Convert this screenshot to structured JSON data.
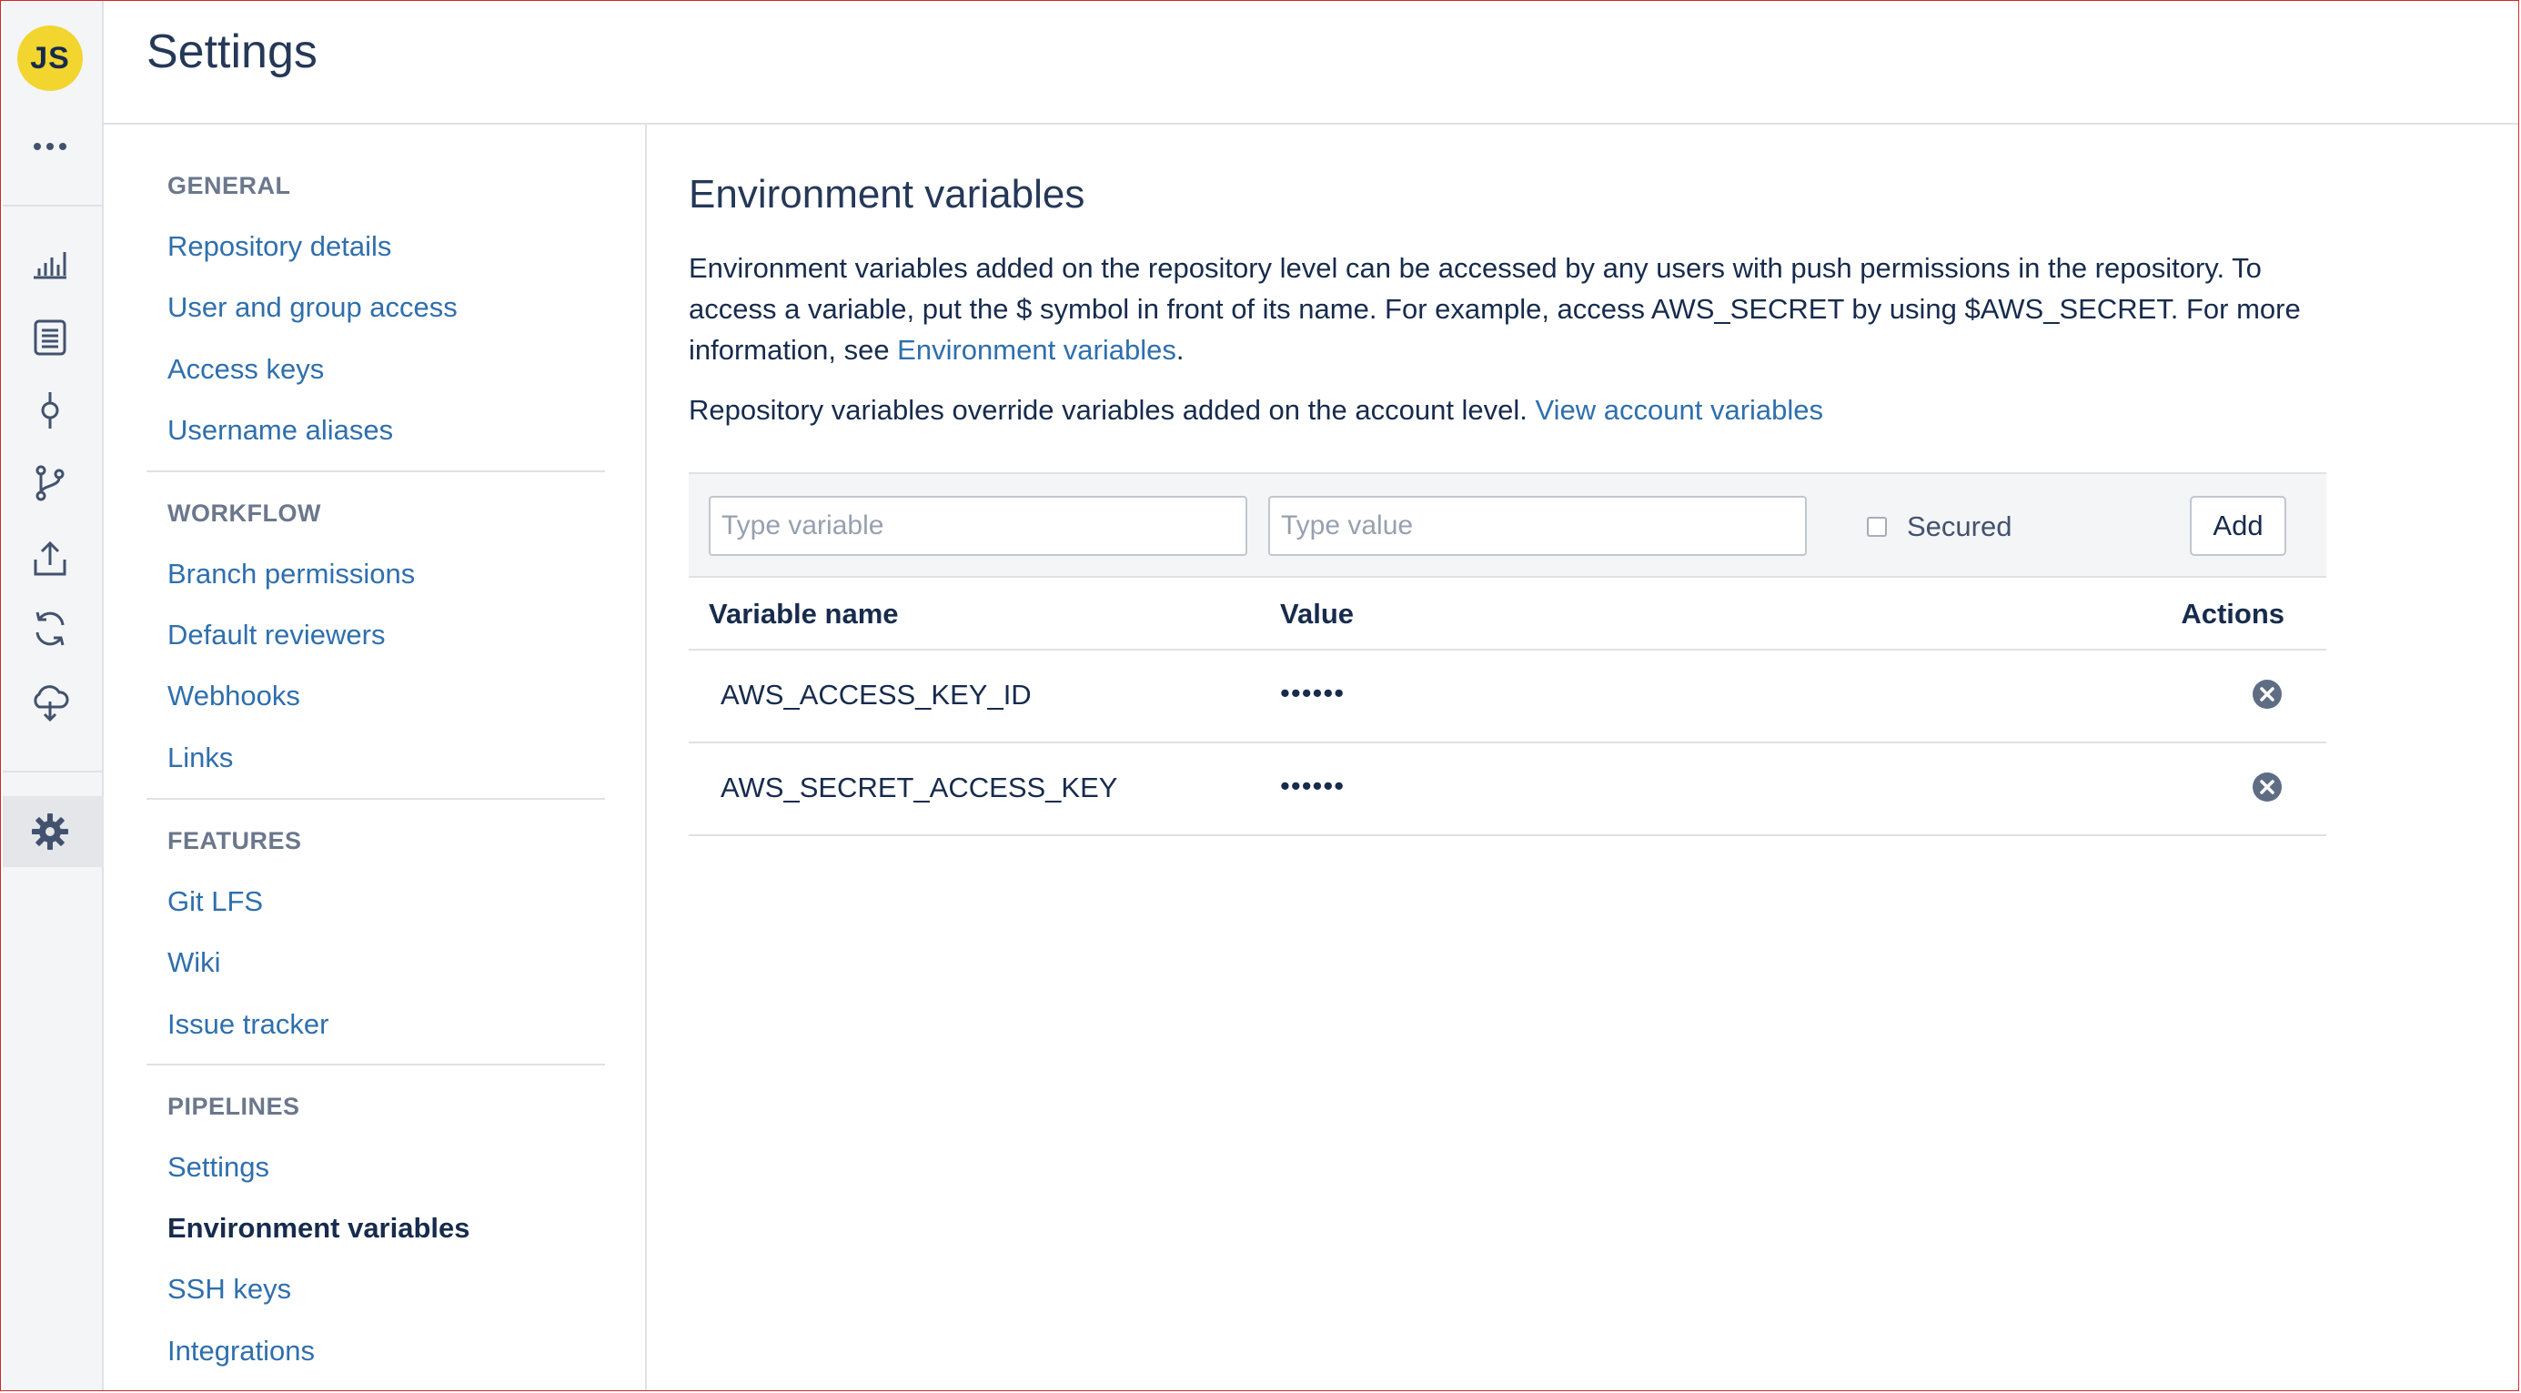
{
  "header": {
    "title": "Settings"
  },
  "user": {
    "initials": "JS"
  },
  "rail": {
    "items": [
      {
        "icon": "more-icon"
      },
      {
        "icon": "chart-icon"
      },
      {
        "icon": "source-icon"
      },
      {
        "icon": "commit-icon"
      },
      {
        "icon": "branch-icon"
      },
      {
        "icon": "deploy-icon"
      },
      {
        "icon": "pipelines-icon"
      },
      {
        "icon": "downloads-icon"
      },
      {
        "icon": "gear-icon",
        "active": true
      }
    ]
  },
  "nav": {
    "sections": [
      {
        "title": "GENERAL",
        "items": [
          "Repository details",
          "User and group access",
          "Access keys",
          "Username aliases"
        ]
      },
      {
        "title": "WORKFLOW",
        "items": [
          "Branch permissions",
          "Default reviewers",
          "Webhooks",
          "Links"
        ]
      },
      {
        "title": "FEATURES",
        "items": [
          "Git LFS",
          "Wiki",
          "Issue tracker"
        ]
      },
      {
        "title": "PIPELINES",
        "items": [
          "Settings",
          "Environment variables",
          "SSH keys",
          "Integrations"
        ]
      }
    ],
    "active_item": "Environment variables"
  },
  "main": {
    "title": "Environment variables",
    "description_text": "Environment variables added on the repository level can be accessed by any users with push permissions in the repository. To access a variable, put the $ symbol in front of its name. For example, access AWS_SECRET by using $AWS_SECRET. For more information, see ",
    "description_link": "Environment variables",
    "description_end": ".",
    "override_text": "Repository variables override variables added on the account level. ",
    "override_link": "View account variables"
  },
  "form": {
    "variable_placeholder": "Type variable",
    "value_placeholder": "Type value",
    "secured_label": "Secured",
    "secured_checked": false,
    "add_label": "Add"
  },
  "table": {
    "headers": {
      "name": "Variable name",
      "value": "Value",
      "actions": "Actions"
    },
    "rows": [
      {
        "name": "AWS_ACCESS_KEY_ID",
        "value": "••••••"
      },
      {
        "name": "AWS_SECRET_ACCESS_KEY",
        "value": "••••••"
      }
    ]
  },
  "colors": {
    "accent_link": "#2f6fad",
    "avatar_bg": "#f2d52f",
    "frame_border": "#d6262b"
  }
}
